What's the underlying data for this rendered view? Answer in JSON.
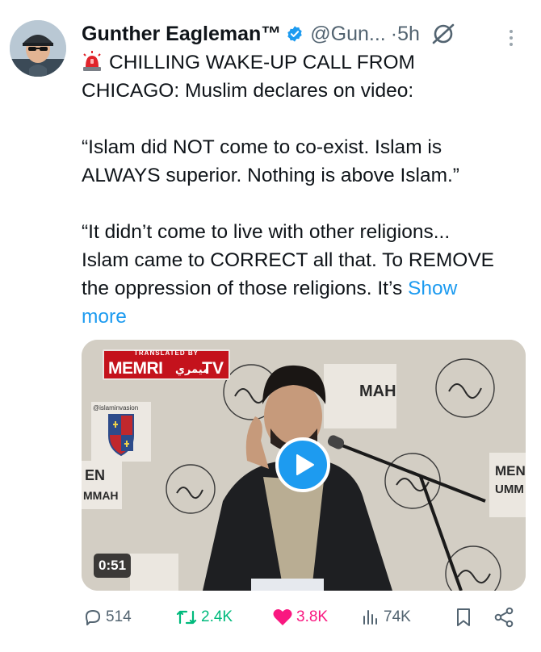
{
  "author": {
    "name": "Gunther Eagleman™",
    "handle": "@Gun...",
    "dot": "·",
    "time": "5h",
    "verified_color": "#1d9bf0"
  },
  "tweet": {
    "line1": "CHILLING WAKE-UP CALL FROM",
    "line2": "CHICAGO: Muslim declares on video:",
    "quote1_line1": "“Islam did NOT come to co-exist. Islam is",
    "quote1_line2": "ALWAYS superior. Nothing is above Islam.”",
    "quote2_line1": "“It didn’t come to live with other religions...",
    "quote2_line2": "Islam came to CORRECT all that. To REMOVE",
    "quote2_line3": "the oppression of those religions. It’s",
    "show_more_1": "Show",
    "show_more_2": "more"
  },
  "media": {
    "watermark_small": "TRANSLATED BY",
    "watermark_brand": "MEMRI",
    "watermark_arabic": "ميمري",
    "watermark_tv": "TV",
    "insta_tag": "@islaminvasion",
    "backdrop_text_1": "EN",
    "backdrop_text_2": "MAH",
    "backdrop_text_3": "MEN",
    "backdrop_text_4": "UMM",
    "backdrop_text_5": "MMAH",
    "duration": "0:51"
  },
  "actions": {
    "replies": "514",
    "reposts": "2.4K",
    "likes": "3.8K",
    "views": "74K"
  },
  "icons": {
    "reply": "reply-icon",
    "repost": "repost-icon",
    "like": "heart-icon",
    "views": "views-icon",
    "bookmark": "bookmark-icon",
    "share": "share-icon",
    "grok": "grok-icon",
    "more": "more-icon",
    "siren": "siren-icon"
  }
}
